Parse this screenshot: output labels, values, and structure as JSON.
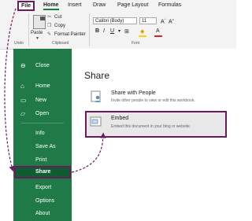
{
  "ribbon": {
    "tabs": [
      "File",
      "Home",
      "Insert",
      "Draw",
      "Page Layout",
      "Formulas"
    ],
    "clipboard": {
      "paste_label": "Paste",
      "cut_label": "Cut",
      "copy_label": "Copy",
      "format_painter_label": "Format Painter",
      "group_label": "Clipboard"
    },
    "undo_group_label": "Undo",
    "font": {
      "font_name": "Calibri (Body)",
      "font_size": "11",
      "group_label": "Font"
    }
  },
  "backstage": {
    "nav": [
      "Close",
      "Home",
      "New",
      "Open",
      "Info",
      "Save As",
      "Print",
      "Share",
      "Export",
      "Options",
      "About"
    ],
    "heading": "Share",
    "options": [
      {
        "title": "Share with People",
        "description": "Invite other people to view or edit this workbook."
      },
      {
        "title": "Embed",
        "description": "Embed this document in your blog or website."
      }
    ]
  },
  "colors": {
    "green": "#1f7a47",
    "highlight": "#6a1b5a"
  }
}
